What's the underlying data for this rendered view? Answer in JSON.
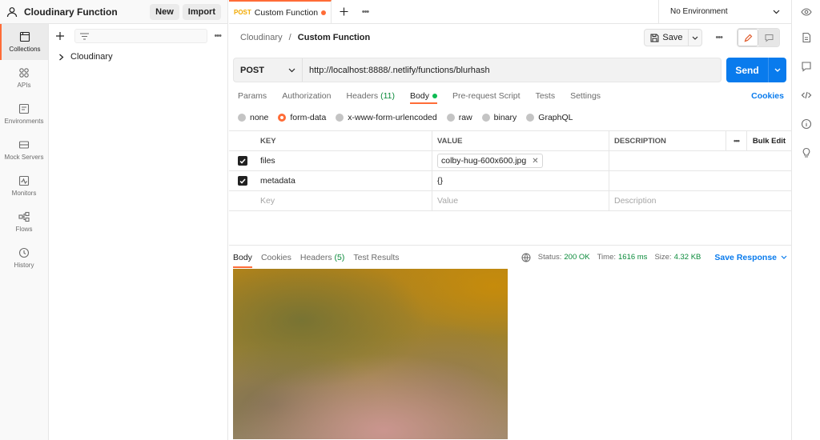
{
  "workspace": {
    "title": "Cloudinary Function",
    "new_label": "New",
    "import_label": "Import"
  },
  "rail": {
    "items": [
      {
        "label": "Collections",
        "icon": "collections-icon",
        "active": true
      },
      {
        "label": "APIs",
        "icon": "apis-icon"
      },
      {
        "label": "Environments",
        "icon": "environments-icon"
      },
      {
        "label": "Mock Servers",
        "icon": "mock-servers-icon"
      },
      {
        "label": "Monitors",
        "icon": "monitors-icon"
      },
      {
        "label": "Flows",
        "icon": "flows-icon"
      },
      {
        "label": "History",
        "icon": "history-icon"
      }
    ]
  },
  "sidebar": {
    "collections": [
      {
        "name": "Cloudinary"
      }
    ]
  },
  "tabs": [
    {
      "method": "POST",
      "name": "Custom Function",
      "unsaved": true
    }
  ],
  "environment": {
    "selected": "No Environment"
  },
  "request": {
    "breadcrumb_parent": "Cloudinary",
    "breadcrumb_sep": "/",
    "breadcrumb_current": "Custom Function",
    "save_label": "Save",
    "method": "POST",
    "url": "http://localhost:8888/.netlify/functions/blurhash",
    "send_label": "Send",
    "tabs": {
      "params": "Params",
      "authorization": "Authorization",
      "headers": "Headers",
      "headers_count": "(11)",
      "body": "Body",
      "prerequest": "Pre-request Script",
      "tests": "Tests",
      "settings": "Settings",
      "cookies": "Cookies"
    },
    "body_types": {
      "none": "none",
      "form_data": "form-data",
      "urlencoded": "x-www-form-urlencoded",
      "raw": "raw",
      "binary": "binary",
      "graphql": "GraphQL"
    },
    "table": {
      "headers": {
        "key": "KEY",
        "value": "VALUE",
        "description": "DESCRIPTION",
        "bulk_edit": "Bulk Edit"
      },
      "rows": [
        {
          "key": "files",
          "value": "colby-hug-600x600.jpg",
          "description": ""
        },
        {
          "key": "metadata",
          "value": "{}",
          "description": ""
        }
      ],
      "placeholder": {
        "key": "Key",
        "value": "Value",
        "description": "Description"
      }
    }
  },
  "response": {
    "tabs": {
      "body": "Body",
      "cookies": "Cookies",
      "headers": "Headers",
      "headers_count": "(5)",
      "test_results": "Test Results"
    },
    "status_label": "Status:",
    "status": "200 OK",
    "time_label": "Time:",
    "time": "1616 ms",
    "size_label": "Size:",
    "size": "4.32 KB",
    "save_response_label": "Save Response"
  },
  "colors": {
    "accent": "#ff6c37",
    "primary": "#097bed",
    "success": "#0a8a3a"
  }
}
